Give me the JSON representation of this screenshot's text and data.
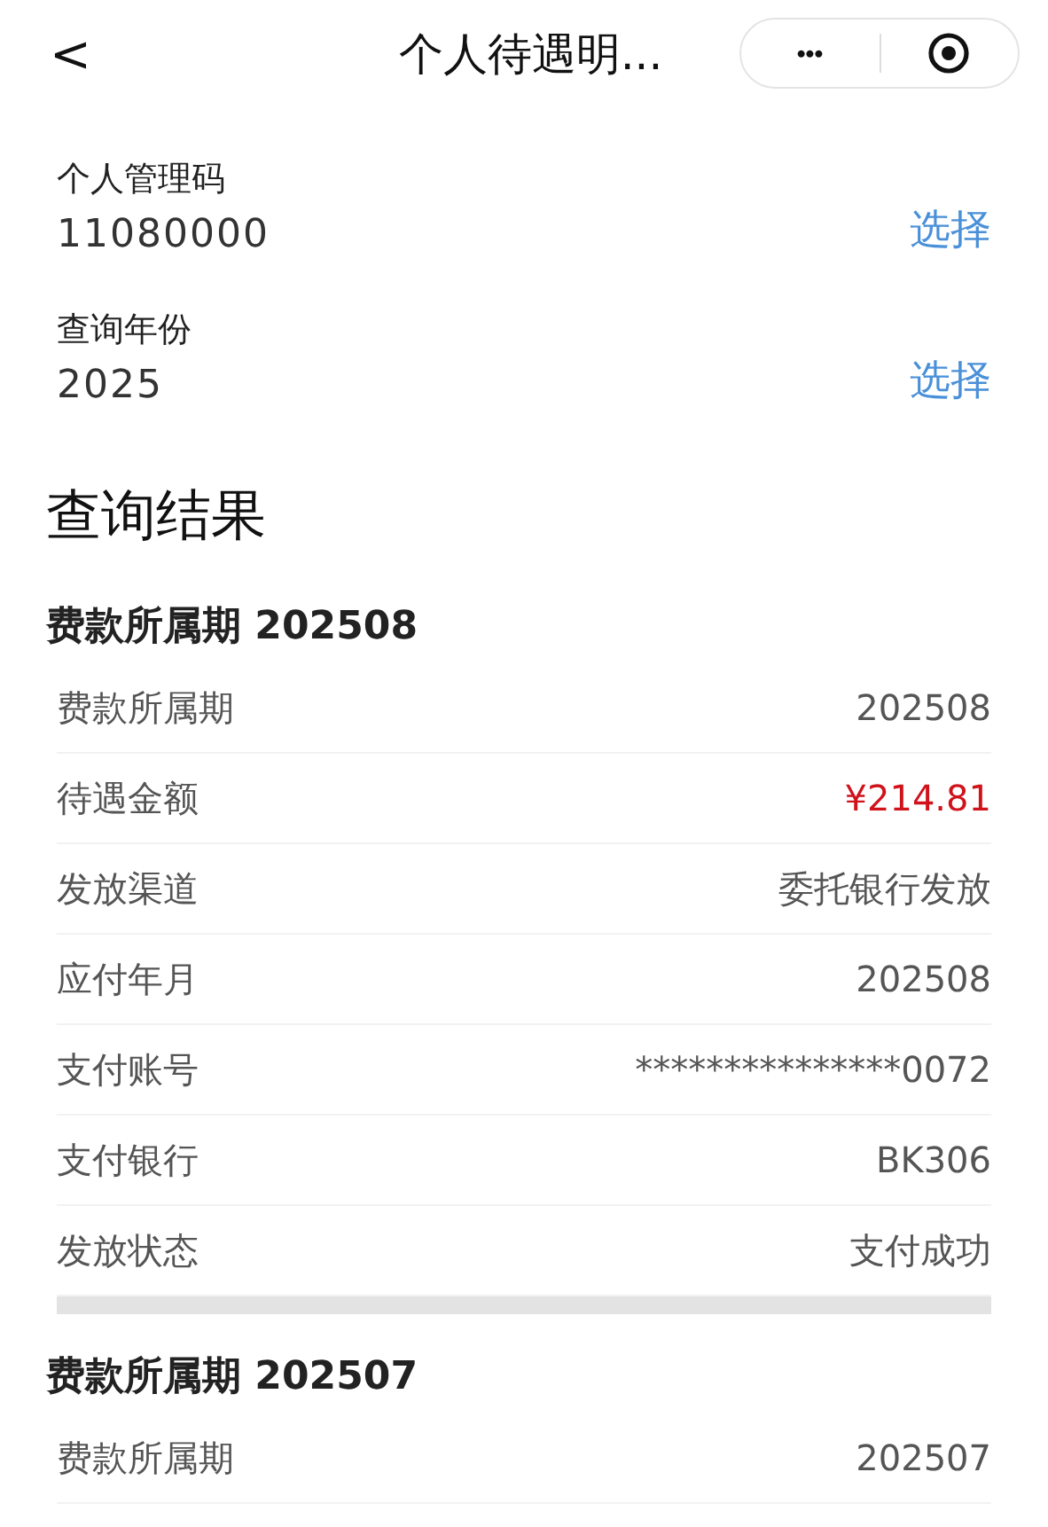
{
  "nav": {
    "back": "<",
    "title": "个人待遇明...",
    "more": "•••"
  },
  "fields": [
    {
      "label": "个人管理码",
      "value": "11080000",
      "action": "选择"
    },
    {
      "label": "查询年份",
      "value": "2025",
      "action": "选择"
    }
  ],
  "results_title": "查询结果",
  "groups": [
    {
      "title": "费款所属期 202508",
      "rows": [
        {
          "label": "费款所属期",
          "value": "202508",
          "kind": "plain"
        },
        {
          "label": "待遇金额",
          "value": "¥214.81",
          "kind": "amount"
        },
        {
          "label": "发放渠道",
          "value": "委托银行发放",
          "kind": "plain"
        },
        {
          "label": "应付年月",
          "value": "202508",
          "kind": "plain"
        },
        {
          "label": "支付账号",
          "value": "***************0072",
          "kind": "plain"
        },
        {
          "label": "支付银行",
          "value": "BK306",
          "kind": "plain"
        },
        {
          "label": "发放状态",
          "value": "支付成功",
          "kind": "plain"
        }
      ]
    },
    {
      "title": "费款所属期 202507",
      "rows": [
        {
          "label": "费款所属期",
          "value": "202507",
          "kind": "plain"
        }
      ]
    }
  ]
}
